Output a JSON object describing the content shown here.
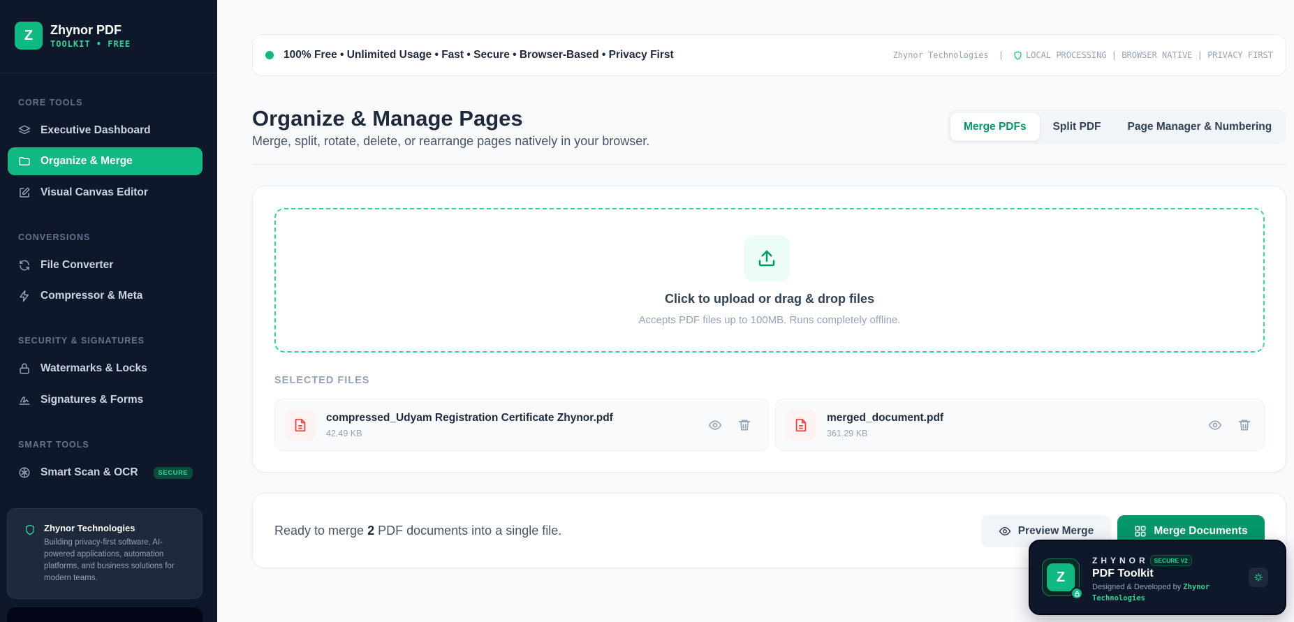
{
  "brand": {
    "logo_letter": "Z",
    "name": "Zhynor PDF",
    "subtitle": "TOOLKIT • FREE"
  },
  "sidebar": {
    "sections": [
      {
        "label": "CORE TOOLS"
      },
      {
        "label": "CONVERSIONS"
      },
      {
        "label": "SECURITY & SIGNATURES"
      },
      {
        "label": "SMART TOOLS"
      }
    ],
    "items": [
      {
        "label": "Executive Dashboard",
        "icon": "layers-icon"
      },
      {
        "label": "Organize & Merge",
        "icon": "folder-icon",
        "active": true
      },
      {
        "label": "Visual Canvas Editor",
        "icon": "edit-icon"
      },
      {
        "label": "File Converter",
        "icon": "refresh-icon"
      },
      {
        "label": "Compressor & Meta",
        "icon": "zap-icon"
      },
      {
        "label": "Watermarks & Locks",
        "icon": "lock-icon"
      },
      {
        "label": "Signatures & Forms",
        "icon": "signature-icon"
      },
      {
        "label": "Smart Scan & OCR",
        "icon": "brain-icon",
        "badge": "SECURE"
      }
    ],
    "about": {
      "title": "Zhynor Technologies",
      "description": "Building privacy-first software, AI-powered applications, automation platforms, and business solutions for modern teams."
    }
  },
  "topbar": {
    "message": "100% Free • Unlimited Usage • Fast • Secure • Browser-Based • Privacy First",
    "company": "Zhynor Technologies",
    "separator": "|",
    "features": "LOCAL PROCESSING | BROWSER NATIVE | PRIVACY FIRST"
  },
  "page": {
    "title": "Organize & Manage Pages",
    "subtitle": "Merge, split, rotate, delete, or rearrange pages natively in your browser.",
    "tabs": [
      {
        "label": "Merge PDFs",
        "active": true
      },
      {
        "label": "Split PDF"
      },
      {
        "label": "Page Manager & Numbering"
      }
    ]
  },
  "upload": {
    "title": "Click to upload or drag & drop files",
    "subtitle": "Accepts PDF files up to 100MB. Runs completely offline."
  },
  "selected_files": {
    "label": "SELECTED FILES",
    "files": [
      {
        "name": "compressed_Udyam Registration Certificate Zhynor.pdf",
        "size": "42.49 KB"
      },
      {
        "name": "merged_document.pdf",
        "size": "361.29 KB"
      }
    ]
  },
  "merge": {
    "text_prefix": "Ready to merge",
    "count": "2",
    "text_suffix": "PDF documents into a single file.",
    "preview_label": "Preview Merge",
    "merge_label": "Merge Documents"
  },
  "widget": {
    "logo_letter": "Z",
    "brand": "ZHYNOR",
    "badge": "SECURE V2",
    "title": "PDF Toolkit",
    "credit_prefix": "Designed & Developed by",
    "credit_name": "Zhynor Technologies"
  },
  "colors": {
    "accent": "#10b981",
    "accent_dark": "#059669",
    "sidebar_bg": "#0f172a",
    "file_icon": "#ef4444"
  }
}
